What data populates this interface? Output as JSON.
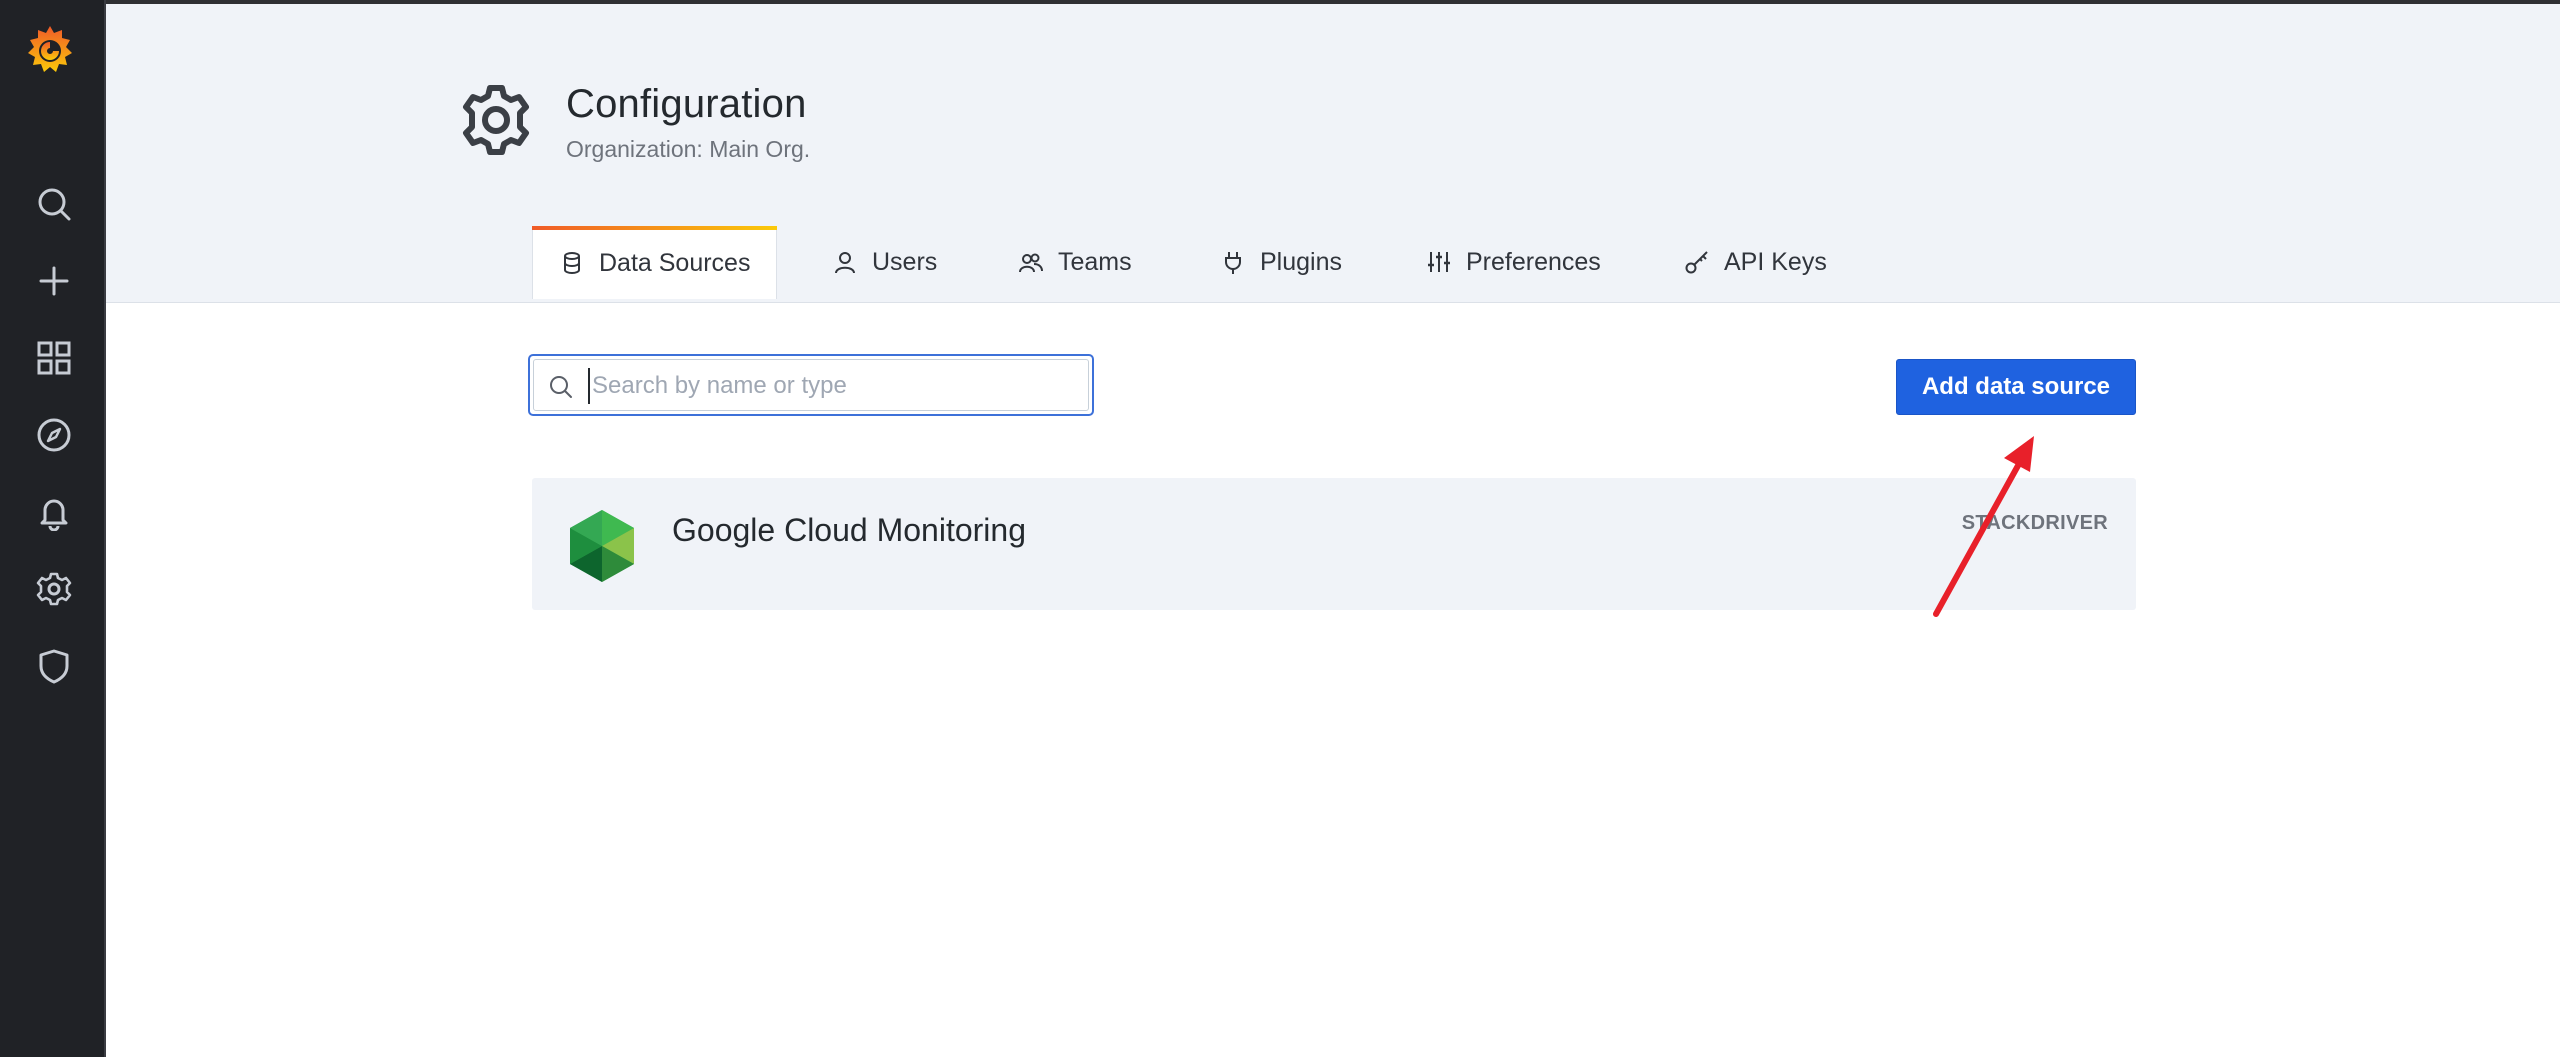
{
  "sidebar": {
    "items": [
      {
        "icon": "search-icon"
      },
      {
        "icon": "plus-icon"
      },
      {
        "icon": "dashboards-icon"
      },
      {
        "icon": "compass-icon"
      },
      {
        "icon": "bell-icon"
      },
      {
        "icon": "gear-icon"
      },
      {
        "icon": "shield-icon"
      }
    ]
  },
  "header": {
    "title": "Configuration",
    "subtitle": "Organization: Main Org.",
    "tabs": [
      {
        "label": "Data Sources",
        "icon": "database-icon",
        "active": true
      },
      {
        "label": "Users",
        "icon": "user-icon"
      },
      {
        "label": "Teams",
        "icon": "users-icon"
      },
      {
        "label": "Plugins",
        "icon": "plug-icon"
      },
      {
        "label": "Preferences",
        "icon": "sliders-icon"
      },
      {
        "label": "API Keys",
        "icon": "key-icon"
      }
    ]
  },
  "main": {
    "search": {
      "placeholder": "Search by name or type",
      "value": ""
    },
    "add_button_label": "Add data source",
    "datasources": [
      {
        "name": "Google Cloud Monitoring",
        "type": "STACKDRIVER",
        "icon": "google-cloud-monitoring-icon"
      }
    ]
  },
  "colors": {
    "sidebar_bg": "#202226",
    "header_bg": "#f0f3f8",
    "primary_button": "#1f62e0",
    "active_tab_gradient_start": "#f05a28",
    "active_tab_gradient_end": "#fbca0a",
    "annotation_arrow": "#e8202a"
  }
}
